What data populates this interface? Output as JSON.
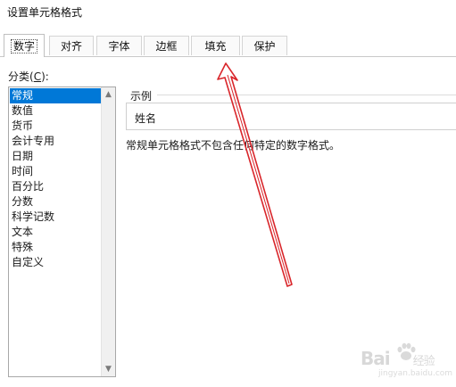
{
  "window": {
    "title": "设置单元格格式"
  },
  "tabs": [
    {
      "label": "数字",
      "active": true
    },
    {
      "label": "对齐",
      "active": false
    },
    {
      "label": "字体",
      "active": false
    },
    {
      "label": "边框",
      "active": false
    },
    {
      "label": "填充",
      "active": false
    },
    {
      "label": "保护",
      "active": false
    }
  ],
  "category": {
    "label_prefix": "分类(",
    "label_hotkey": "C",
    "label_suffix": "):",
    "selected": "常规",
    "items": [
      "常规",
      "数值",
      "货币",
      "会计专用",
      "日期",
      "时间",
      "百分比",
      "分数",
      "科学记数",
      "文本",
      "特殊",
      "自定义"
    ]
  },
  "sample": {
    "label": "示例",
    "value": "姓名"
  },
  "description": "常规单元格格式不包含任何特定的数字格式。",
  "watermark": {
    "brand": "Bai",
    "brand_suffix": "经验",
    "sub": "jingyan.baidu.com"
  },
  "colors": {
    "accent": "#0078d7",
    "annotation_arrow": "#d9262b"
  }
}
